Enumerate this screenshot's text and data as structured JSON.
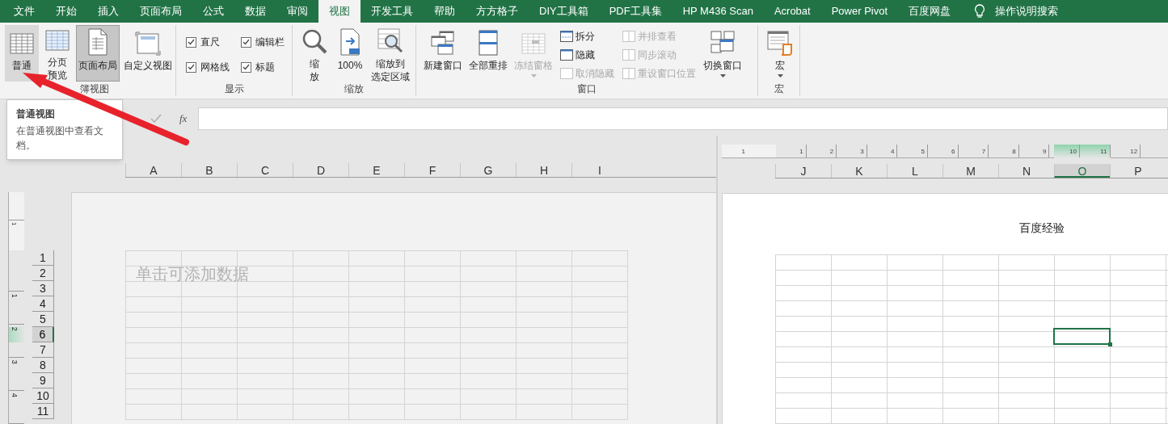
{
  "tabs": [
    {
      "label": "文件",
      "selected": false
    },
    {
      "label": "开始",
      "selected": false
    },
    {
      "label": "插入",
      "selected": false
    },
    {
      "label": "页面布局",
      "selected": false
    },
    {
      "label": "公式",
      "selected": false
    },
    {
      "label": "数据",
      "selected": false
    },
    {
      "label": "审阅",
      "selected": false
    },
    {
      "label": "视图",
      "selected": true
    },
    {
      "label": "开发工具",
      "selected": false
    },
    {
      "label": "帮助",
      "selected": false
    },
    {
      "label": "方方格子",
      "selected": false
    },
    {
      "label": "DIY工具箱",
      "selected": false
    },
    {
      "label": "PDF工具集",
      "selected": false
    },
    {
      "label": "HP M436 Scan",
      "selected": false
    },
    {
      "label": "Acrobat",
      "selected": false
    },
    {
      "label": "Power Pivot",
      "selected": false
    },
    {
      "label": "百度网盘",
      "selected": false
    }
  ],
  "tell_me": "操作说明搜索",
  "ribbon": [
    {
      "label": "簿视图",
      "items": [
        {
          "kind": "large",
          "label": "普通",
          "selected": false,
          "hovered": true
        },
        {
          "kind": "large",
          "label": [
            "分页",
            "预览"
          ],
          "selected": false,
          "hovered": false
        },
        {
          "kind": "large",
          "label": "页面布局",
          "selected": true,
          "hovered": false
        },
        {
          "kind": "large",
          "label": "自定义视图",
          "selected": false,
          "hovered": false
        }
      ]
    },
    {
      "label": "显示",
      "items": [
        {
          "kind": "stack",
          "items": [
            {
              "kind": "checkbox",
              "label": "直尺",
              "checked": true
            },
            {
              "kind": "checkbox",
              "label": "网格线",
              "checked": true
            }
          ]
        },
        {
          "kind": "stack",
          "items": [
            {
              "kind": "checkbox",
              "label": "编辑栏",
              "checked": true
            },
            {
              "kind": "checkbox",
              "label": "标题",
              "checked": true
            }
          ]
        }
      ]
    },
    {
      "label": "缩放",
      "items": [
        {
          "kind": "large",
          "label": [
            "缩",
            "放"
          ]
        },
        {
          "kind": "large",
          "label": "100%"
        },
        {
          "kind": "large",
          "label": [
            "缩放到",
            "选定区域"
          ]
        }
      ]
    },
    {
      "label": "窗口",
      "items": [
        {
          "kind": "large",
          "label": "新建窗口",
          "disabled": false
        },
        {
          "kind": "large",
          "label": "全部重排",
          "disabled": false
        },
        {
          "kind": "large",
          "label": "冻结窗格",
          "disabled": true,
          "has_menu": true
        },
        {
          "kind": "stack",
          "items": [
            {
              "kind": "small",
              "label": "拆分",
              "disabled": false
            },
            {
              "kind": "small",
              "label": "隐藏",
              "disabled": false
            },
            {
              "kind": "small",
              "label": "取消隐藏",
              "disabled": true
            }
          ]
        },
        {
          "kind": "stack",
          "items": [
            {
              "kind": "small",
              "label": "并排查看",
              "disabled": true
            },
            {
              "kind": "small",
              "label": "同步滚动",
              "disabled": true
            },
            {
              "kind": "small",
              "label": "重设窗口位置",
              "disabled": true
            }
          ]
        },
        {
          "kind": "large",
          "label": "切换窗口",
          "disabled": false,
          "has_menu": true
        }
      ]
    },
    {
      "label": "宏",
      "items": [
        {
          "kind": "large",
          "label": "宏",
          "has_menu": true
        }
      ]
    }
  ],
  "formula_bar": {
    "function_label": "fx"
  },
  "tooltip": {
    "title": "普通视图",
    "text": "在普通视图中查看文档。"
  },
  "left_pane": {
    "vertical_ruler": [
      "1",
      "1",
      "2",
      "3",
      "4"
    ],
    "columns": [
      {
        "label": "A",
        "selected": false
      },
      {
        "label": "B",
        "selected": false
      },
      {
        "label": "C",
        "selected": false
      },
      {
        "label": "D",
        "selected": false
      },
      {
        "label": "E",
        "selected": false
      },
      {
        "label": "F",
        "selected": false
      },
      {
        "label": "G",
        "selected": false
      },
      {
        "label": "H",
        "selected": false
      },
      {
        "label": "I",
        "selected": false
      }
    ],
    "rows": [
      {
        "label": "1",
        "selected": false
      },
      {
        "label": "2",
        "selected": false
      },
      {
        "label": "3",
        "selected": false
      },
      {
        "label": "4",
        "selected": false
      },
      {
        "label": "5",
        "selected": false
      },
      {
        "label": "6",
        "selected": true
      },
      {
        "label": "7",
        "selected": false
      },
      {
        "label": "8",
        "selected": false
      },
      {
        "label": "9",
        "selected": false
      },
      {
        "label": "10",
        "selected": false
      },
      {
        "label": "11",
        "selected": false
      }
    ],
    "header_placeholder": "单击可添加数据"
  },
  "right_pane": {
    "ruler": [
      "1",
      "1",
      "2",
      "3",
      "4",
      "5",
      "6",
      "7",
      "8",
      "9",
      "10",
      "11",
      "12"
    ],
    "columns": [
      {
        "label": "J",
        "selected": false
      },
      {
        "label": "K",
        "selected": false
      },
      {
        "label": "L",
        "selected": false
      },
      {
        "label": "M",
        "selected": false
      },
      {
        "label": "N",
        "selected": false
      },
      {
        "label": "O",
        "selected": true
      },
      {
        "label": "P",
        "selected": false
      }
    ],
    "page_header": "百度经验"
  }
}
